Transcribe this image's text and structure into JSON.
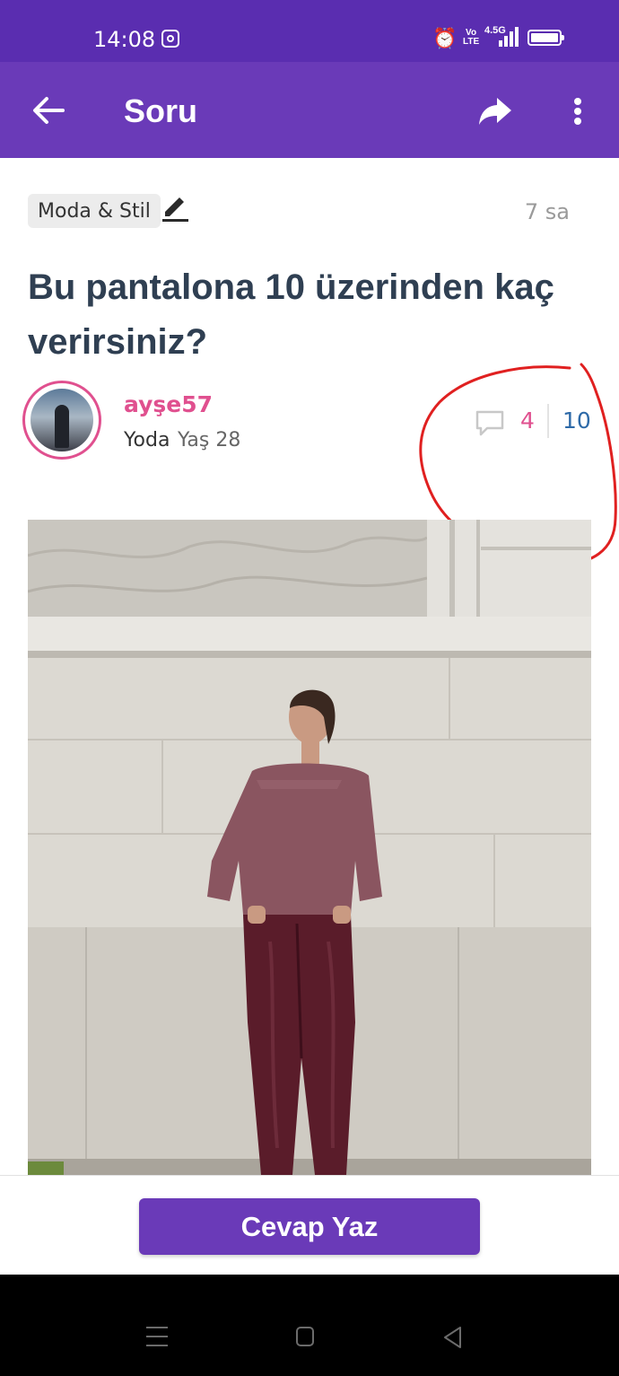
{
  "status_bar": {
    "time": "14:08",
    "volte": "Vo\nLTE",
    "network": "4.5G"
  },
  "app_bar": {
    "title": "Soru"
  },
  "question": {
    "category": "Moda & Stil",
    "time_ago": "7 sa",
    "title": "Bu pantalona 10 üzerinden kaç verirsiniz?"
  },
  "author": {
    "username": "ayşe57",
    "rank": "Yoda",
    "age": "Yaş 28"
  },
  "stats": {
    "comments": "4",
    "views": "10"
  },
  "actions": {
    "answer_label": "Cevap Yaz"
  },
  "colors": {
    "primary": "#6a3ab8",
    "status_bar": "#5a2db0",
    "accent_pink": "#e0508f",
    "title_text": "#2f3f52",
    "view_blue": "#2e6aa8",
    "annotation_red": "#e02020"
  },
  "icons": {
    "back": "arrow-left-icon",
    "share": "share-icon",
    "more": "more-vertical-icon",
    "edit": "pencil-icon",
    "comment": "comment-bubble-icon"
  }
}
